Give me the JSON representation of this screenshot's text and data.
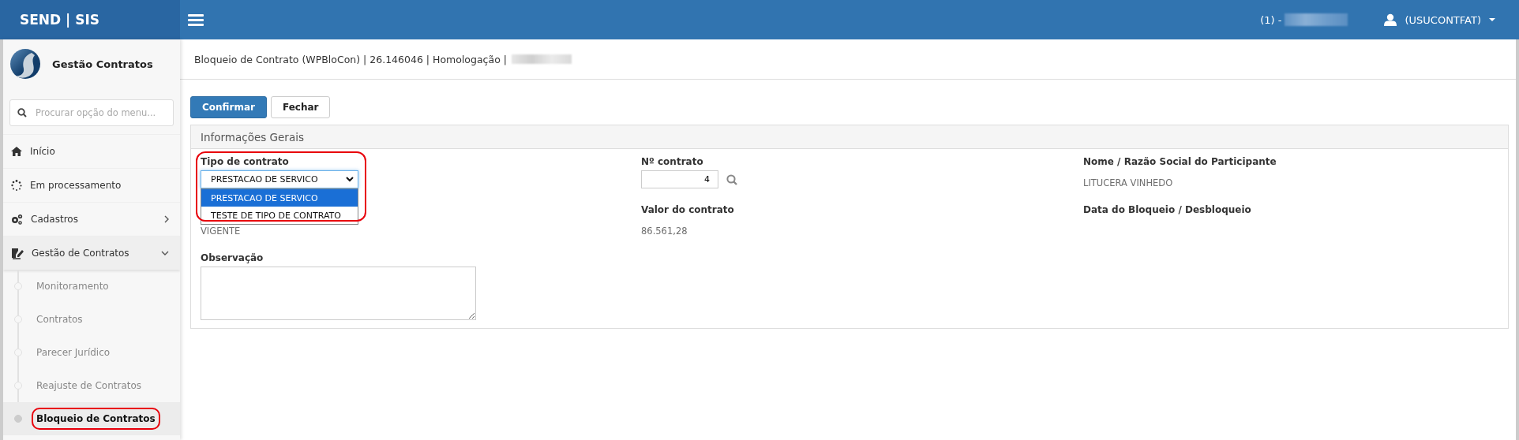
{
  "header": {
    "brand": "SEND | SIS",
    "company": "(1) -",
    "user": "(USUCONTFAT)"
  },
  "sidebar": {
    "module": "Gestão Contratos",
    "search": {
      "placeholder": "Procurar opção do menu..."
    },
    "items": [
      {
        "label": "Início",
        "kind": "home"
      },
      {
        "label": "Em processamento",
        "kind": "spinner"
      },
      {
        "label": "Cadastros",
        "kind": "gears",
        "expanded": false
      },
      {
        "label": "Gestão de Contratos",
        "kind": "edit",
        "expanded": true,
        "children": [
          {
            "label": "Monitoramento",
            "selected": false,
            "highlighted": false
          },
          {
            "label": "Contratos",
            "selected": false,
            "highlighted": false
          },
          {
            "label": "Parecer Jurídico",
            "selected": false,
            "highlighted": false
          },
          {
            "label": "Reajuste de Contratos",
            "selected": false,
            "highlighted": false
          },
          {
            "label": "Bloqueio de Contratos",
            "selected": true,
            "highlighted": true
          }
        ]
      }
    ]
  },
  "breadcrumb": "Bloqueio de Contrato (WPBloCon) | 26.146046 | Homologação |",
  "buttons": [
    {
      "label": "Confirmar",
      "kind": "primary"
    },
    {
      "label": "Fechar",
      "kind": "default"
    }
  ],
  "panel": {
    "title": "Informações Gerais",
    "fields": [
      {
        "kind": "select",
        "label": "Tipo de contrato",
        "value": "PRESTACAO DE SERVICO",
        "expanded": true,
        "highlighted": true,
        "options": [
          {
            "label": "PRESTACAO DE SERVICO",
            "selected": true
          },
          {
            "label": "TESTE DE TIPO DE CONTRATO",
            "selected": false
          }
        ]
      },
      {
        "kind": "input",
        "label": "Nº contrato",
        "value": "4"
      },
      {
        "kind": "text",
        "label": "Nome / Razão Social do Participante",
        "value": "LITUCERA VINHEDO"
      },
      {
        "kind": "text",
        "value": "VIGENTE"
      },
      {
        "kind": "text",
        "label": "Valor do contrato",
        "value": "86.561,28"
      },
      {
        "kind": "text",
        "label": "Data do Bloqueio / Desbloqueio"
      },
      {
        "kind": "textarea",
        "label": "Observação"
      }
    ]
  }
}
